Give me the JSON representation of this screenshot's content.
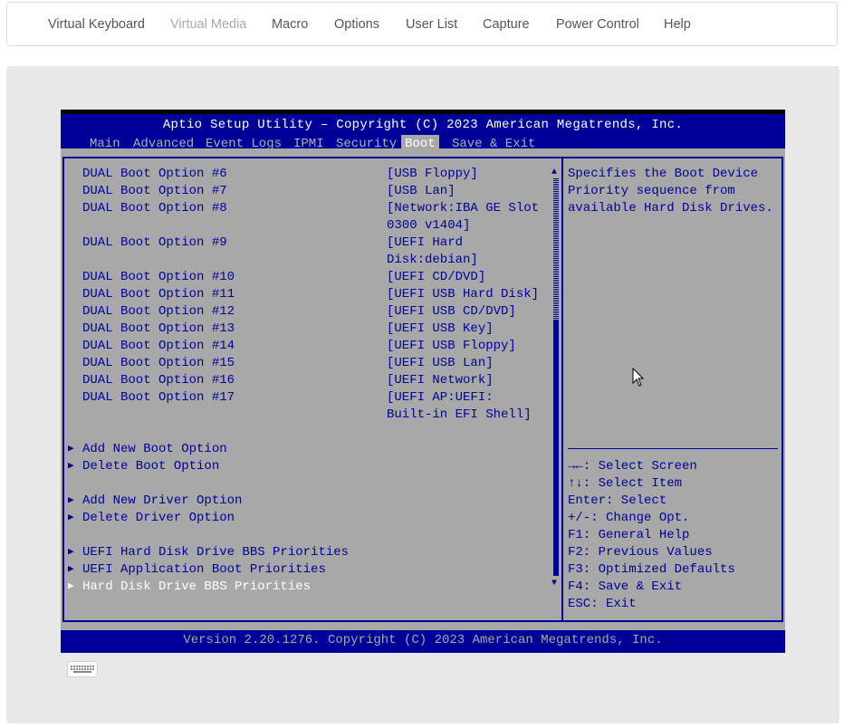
{
  "nav": {
    "items": [
      {
        "label": "Virtual Keyboard",
        "disabled": false
      },
      {
        "label": "Virtual Media",
        "disabled": true
      },
      {
        "label": "Macro",
        "disabled": false
      },
      {
        "label": "Options",
        "disabled": false
      },
      {
        "label": "User List",
        "disabled": false
      },
      {
        "label": "Capture",
        "disabled": false
      },
      {
        "label": "Power Control",
        "disabled": false
      },
      {
        "label": "Help",
        "disabled": false
      }
    ]
  },
  "bios": {
    "title": "Aptio Setup Utility – Copyright (C) 2023 American Megatrends, Inc.",
    "tabs": [
      "Main",
      "Advanced",
      "Event Logs",
      "IPMI",
      "Security",
      "Boot",
      "Save & Exit"
    ],
    "active_tab": "Boot",
    "options": [
      {
        "label": "DUAL Boot Option #6",
        "value": [
          "[USB Floppy]"
        ]
      },
      {
        "label": "DUAL Boot Option #7",
        "value": [
          "[USB Lan]"
        ]
      },
      {
        "label": "DUAL Boot Option #8",
        "value": [
          "[Network:IBA GE Slot",
          "0300 v1404]"
        ]
      },
      {
        "label": "DUAL Boot Option #9",
        "value": [
          "[UEFI Hard",
          "Disk:debian]"
        ]
      },
      {
        "label": "DUAL Boot Option #10",
        "value": [
          "[UEFI CD/DVD]"
        ]
      },
      {
        "label": "DUAL Boot Option #11",
        "value": [
          "[UEFI USB Hard Disk]"
        ]
      },
      {
        "label": "DUAL Boot Option #12",
        "value": [
          "[UEFI USB CD/DVD]"
        ]
      },
      {
        "label": "DUAL Boot Option #13",
        "value": [
          "[UEFI USB Key]"
        ]
      },
      {
        "label": "DUAL Boot Option #14",
        "value": [
          "[UEFI USB Floppy]"
        ]
      },
      {
        "label": "DUAL Boot Option #15",
        "value": [
          "[UEFI USB Lan]"
        ]
      },
      {
        "label": "DUAL Boot Option #16",
        "value": [
          "[UEFI Network]"
        ]
      },
      {
        "label": "DUAL Boot Option #17",
        "value": [
          "[UEFI AP:UEFI:",
          "Built-in EFI Shell]"
        ]
      }
    ],
    "submenus": [
      {
        "label": "Add New Boot Option",
        "selected": false
      },
      {
        "label": "Delete Boot Option",
        "selected": false
      },
      {
        "label": "Add New Driver Option",
        "selected": false
      },
      {
        "label": "Delete Driver Option",
        "selected": false
      },
      {
        "label": "UEFI Hard Disk Drive BBS Priorities",
        "selected": false
      },
      {
        "label": "UEFI Application Boot Priorities",
        "selected": false
      },
      {
        "label": "Hard Disk Drive BBS Priorities",
        "selected": true
      }
    ],
    "help_text": [
      "Specifies the Boot Device",
      "Priority sequence from",
      "available Hard Disk Drives."
    ],
    "key_help": [
      "→←: Select Screen",
      "↑↓: Select Item",
      "Enter: Select",
      "+/-: Change Opt.",
      "F1: General Help",
      "F2: Previous Values",
      "F3: Optimized Defaults",
      "F4: Save & Exit",
      "ESC: Exit"
    ],
    "footer": "Version 2.20.1276. Copyright (C) 2023 American Megatrends, Inc."
  },
  "colors": {
    "bios_blue": "#000099",
    "bios_gray": "#a8a8a8",
    "panel_bg": "#e8e8e8"
  },
  "icons": [
    "keyboard-icon",
    "scroll-up-arrow-icon",
    "scroll-down-arrow-icon",
    "submenu-arrow-icon",
    "mouse-cursor-icon"
  ]
}
